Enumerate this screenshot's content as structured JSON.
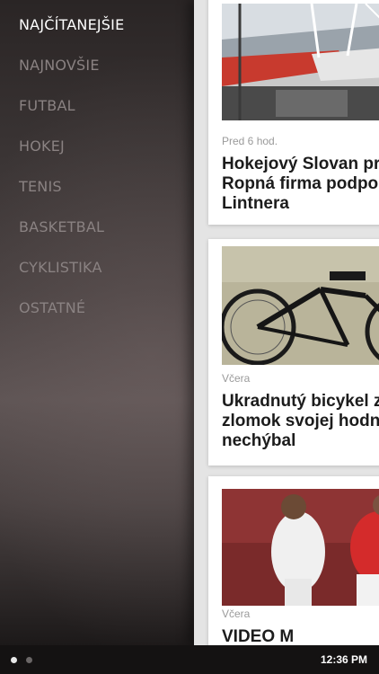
{
  "menu": {
    "items": [
      {
        "label": "NAJČÍTANEJŠIE",
        "active": true
      },
      {
        "label": "NAJNOVŠIE",
        "active": false
      },
      {
        "label": "FUTBAL",
        "active": false
      },
      {
        "label": "HOKEJ",
        "active": false
      },
      {
        "label": "TENIS",
        "active": false
      },
      {
        "label": "BASKETBAL",
        "active": false
      },
      {
        "label": "CYKLISTIKA",
        "active": false
      },
      {
        "label": "OSTATNÉ",
        "active": false
      }
    ]
  },
  "articles": [
    {
      "time": "Pred 6 hod.",
      "title": "Hokejový Slovan pri\nRopná firma podpor\nLintnera",
      "image": "stadium-photo"
    },
    {
      "time": "Včera",
      "title": "Ukradnutý bicykel z\nzlomok svojej hodno\nnechýbal",
      "image": "racing-bicycle-photo"
    },
    {
      "time": "Včera",
      "title": "VIDEO M",
      "image": "football-match-photo"
    }
  ],
  "statusbar": {
    "time": "12:36 PM"
  },
  "colors": {
    "active_menu": "#ffffff",
    "inactive_menu": "#8a8282",
    "card_bg": "#ffffff"
  }
}
